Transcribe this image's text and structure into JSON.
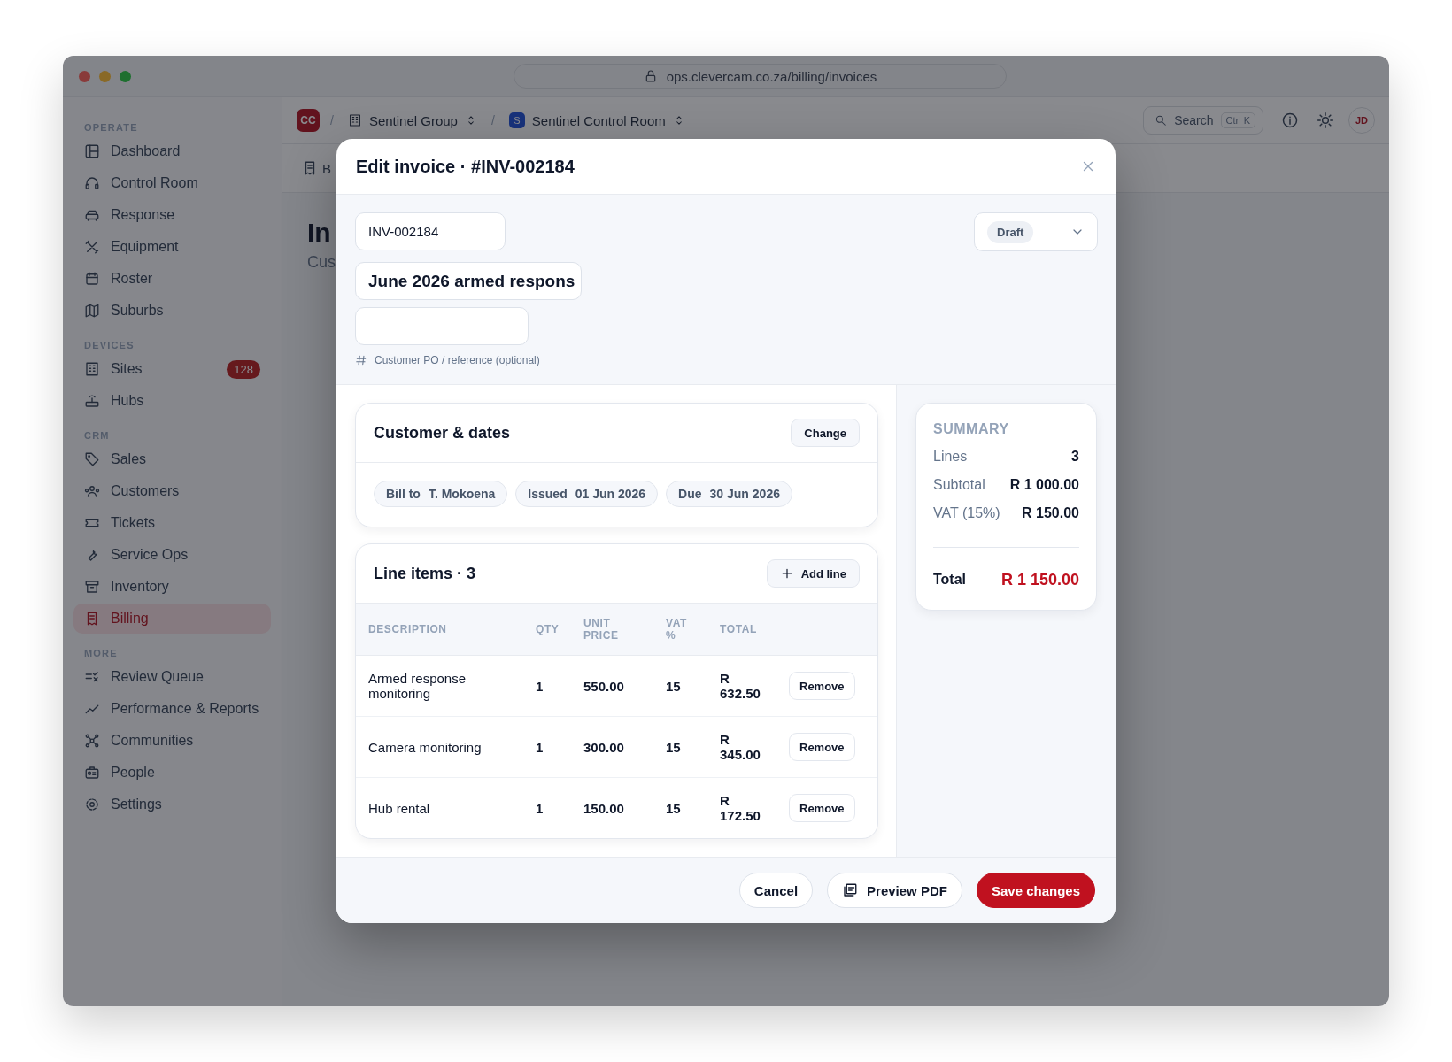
{
  "browser": {
    "url": "ops.clevercam.co.za/billing/invoices"
  },
  "sidebar": {
    "sections": [
      {
        "label": "OPERATE",
        "items": [
          {
            "label": "Dashboard",
            "selected": false
          },
          {
            "label": "Control Room",
            "selected": false
          },
          {
            "label": "Response",
            "selected": false
          },
          {
            "label": "Equipment",
            "selected": false
          },
          {
            "label": "Roster",
            "selected": false
          },
          {
            "label": "Suburbs",
            "selected": false
          }
        ]
      },
      {
        "label": "DEVICES",
        "items": [
          {
            "label": "Sites",
            "selected": false,
            "badge": "128"
          },
          {
            "label": "Hubs",
            "selected": false
          }
        ]
      },
      {
        "label": "CRM",
        "items": [
          {
            "label": "Sales",
            "selected": false
          },
          {
            "label": "Customers",
            "selected": false
          },
          {
            "label": "Tickets",
            "selected": false
          },
          {
            "label": "Service Ops",
            "selected": false
          },
          {
            "label": "Inventory",
            "selected": false
          },
          {
            "label": "Billing",
            "selected": true
          }
        ]
      },
      {
        "label": "MORE",
        "items": [
          {
            "label": "Review Queue",
            "selected": false
          },
          {
            "label": "Performance & Reports",
            "selected": false
          },
          {
            "label": "Communities",
            "selected": false
          },
          {
            "label": "People",
            "selected": false
          },
          {
            "label": "Settings",
            "selected": false
          }
        ]
      }
    ]
  },
  "topbar": {
    "logo": "CC",
    "separators": [
      "/",
      "/"
    ],
    "organization": "Sentinel Group",
    "workspace_badge": "S",
    "workspace": "Sentinel Control Room",
    "search": {
      "placeholder": "Search",
      "shortcut": "Ctrl K"
    },
    "avatar": "JD"
  },
  "page": {
    "breadcrumb": "B",
    "title": "In",
    "subtitle": "Cus"
  },
  "modal": {
    "title": "Edit invoice · #INV-002184",
    "invoice_number": "INV-002184",
    "status": "Draft",
    "invoice_title": "June 2026 armed respons",
    "po_field": {
      "hint": "Customer PO / reference (optional)"
    },
    "customer_card": {
      "title": "Customer & dates",
      "button": "Change",
      "chips": [
        {
          "label": "Bill to",
          "value": "T. Mokoena"
        },
        {
          "label": "Issued",
          "value": "01 Jun 2026"
        },
        {
          "label": "Due",
          "value": "30 Jun 2026"
        }
      ]
    },
    "line_items": {
      "title": "Line items · 3",
      "button": "Add line",
      "columns": [
        "DESCRIPTION",
        "QTY",
        "UNIT PRICE",
        "VAT %",
        "TOTAL"
      ],
      "rows": [
        {
          "description": "Armed response monitoring",
          "qty": "1",
          "unit_price": "550.00",
          "vat": "15",
          "total": "R 632.50",
          "action": "Remove"
        },
        {
          "description": "Camera monitoring",
          "qty": "1",
          "unit_price": "300.00",
          "vat": "15",
          "total": "R 345.00",
          "action": "Remove"
        },
        {
          "description": "Hub rental",
          "qty": "1",
          "unit_price": "150.00",
          "vat": "15",
          "total": "R 172.50",
          "action": "Remove"
        }
      ]
    },
    "summary": {
      "title": "SUMMARY",
      "rows": [
        {
          "label": "Lines",
          "value": "3"
        },
        {
          "label": "Subtotal",
          "value": "R 1 000.00"
        },
        {
          "label": "VAT (15%)",
          "value": "R 150.00"
        }
      ],
      "total": {
        "label": "Total",
        "value": "R 1 150.00"
      }
    },
    "buttons": [
      {
        "label": "Cancel",
        "kind": "secondary"
      },
      {
        "label": "Preview PDF",
        "kind": "pdf"
      },
      {
        "label": "Save changes",
        "kind": "primary"
      }
    ]
  }
}
